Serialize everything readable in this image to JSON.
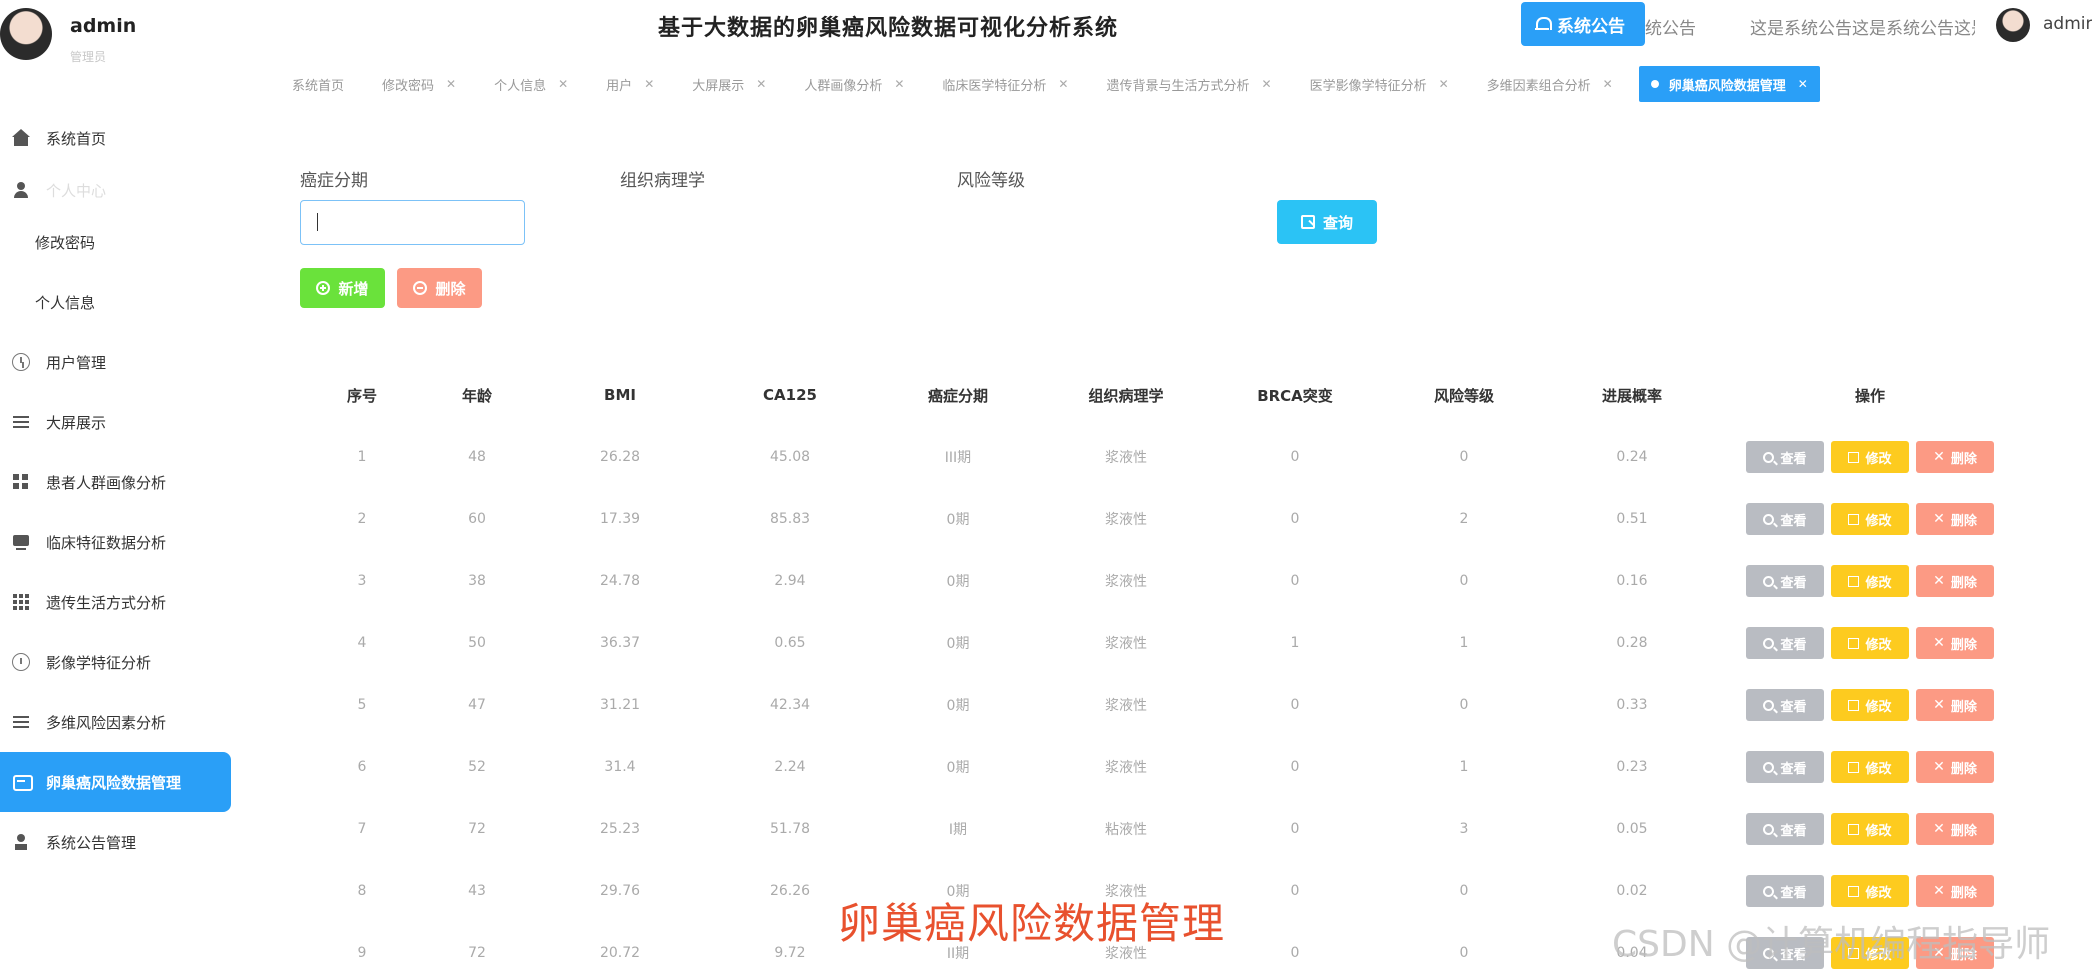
{
  "header": {
    "user_name": "admin",
    "user_role": "管理员",
    "title": "基于大数据的卵巢癌风险数据可视化分析系统",
    "notice_button": "系统公告",
    "notice_tail": "统公告",
    "notice_marquee": "这是系统公告这是系统公告这是系统公告",
    "right_user": "admin"
  },
  "tabs": [
    {
      "label": "系统首页",
      "closable": false
    },
    {
      "label": "修改密码",
      "closable": true
    },
    {
      "label": "个人信息",
      "closable": true
    },
    {
      "label": "用户",
      "closable": true
    },
    {
      "label": "大屏展示",
      "closable": true
    },
    {
      "label": "人群画像分析",
      "closable": true
    },
    {
      "label": "临床医学特征分析",
      "closable": true
    },
    {
      "label": "遗传背景与生活方式分析",
      "closable": true
    },
    {
      "label": "医学影像学特征分析",
      "closable": true
    },
    {
      "label": "多维因素组合分析",
      "closable": true
    },
    {
      "label": "卵巢癌风险数据管理",
      "closable": true,
      "active": true
    }
  ],
  "sidebar": {
    "items": [
      {
        "label": "系统首页",
        "icon": "home-icon"
      },
      {
        "label": "个人中心",
        "icon": "user-icon"
      },
      {
        "label": "修改密码",
        "icon": ""
      },
      {
        "label": "个人信息",
        "icon": ""
      },
      {
        "label": "用户管理",
        "icon": "clock-icon"
      },
      {
        "label": "大屏展示",
        "icon": "list-icon"
      },
      {
        "label": "患者人群画像分析",
        "icon": "grid-icon"
      },
      {
        "label": "临床特征数据分析",
        "icon": "monitor-icon"
      },
      {
        "label": "遗传生活方式分析",
        "icon": "apps-icon"
      },
      {
        "label": "影像学特征分析",
        "icon": "gauge-icon"
      },
      {
        "label": "多维风险因素分析",
        "icon": "list-icon"
      },
      {
        "label": "卵巢癌风险数据管理",
        "icon": "message-icon"
      },
      {
        "label": "系统公告管理",
        "icon": "person-icon"
      }
    ]
  },
  "filters": {
    "stage_label": "癌症分期",
    "stage_value": "",
    "pathology_label": "组织病理学",
    "risk_label": "风险等级",
    "search_button": "查询"
  },
  "toolbar": {
    "add_button": "新增",
    "delete_button": "删除"
  },
  "table": {
    "headers": [
      "序号",
      "年龄",
      "BMI",
      "CA125",
      "癌症分期",
      "组织病理学",
      "BRCA突变",
      "风险等级",
      "进展概率",
      "操作"
    ],
    "actions": {
      "view": "查看",
      "edit": "修改",
      "delete": "删除"
    },
    "rows": [
      [
        "1",
        "48",
        "26.28",
        "45.08",
        "III期",
        "浆液性",
        "0",
        "0",
        "0.24"
      ],
      [
        "2",
        "60",
        "17.39",
        "85.83",
        "0期",
        "浆液性",
        "0",
        "2",
        "0.51"
      ],
      [
        "3",
        "38",
        "24.78",
        "2.94",
        "0期",
        "浆液性",
        "0",
        "0",
        "0.16"
      ],
      [
        "4",
        "50",
        "36.37",
        "0.65",
        "0期",
        "浆液性",
        "1",
        "1",
        "0.28"
      ],
      [
        "5",
        "47",
        "31.21",
        "42.34",
        "0期",
        "浆液性",
        "0",
        "0",
        "0.33"
      ],
      [
        "6",
        "52",
        "31.4",
        "2.24",
        "0期",
        "浆液性",
        "0",
        "1",
        "0.23"
      ],
      [
        "7",
        "72",
        "25.23",
        "51.78",
        "I期",
        "粘液性",
        "0",
        "3",
        "0.05"
      ],
      [
        "8",
        "43",
        "29.76",
        "26.26",
        "0期",
        "浆液性",
        "0",
        "0",
        "0.02"
      ],
      [
        "9",
        "72",
        "20.72",
        "9.72",
        "II期",
        "浆液性",
        "0",
        "0",
        "0.04"
      ]
    ]
  },
  "overlay": {
    "caption": "卵巢癌风险数据管理",
    "watermark": "CSDN @计算机编程指导师"
  },
  "colors": {
    "primary": "#2a9ff7",
    "search": "#2bc3f5",
    "add": "#6ae23b",
    "delete": "#fc9a84",
    "edit": "#fdcb1f",
    "view": "#b9bcc2",
    "caption": "#e8512e"
  }
}
